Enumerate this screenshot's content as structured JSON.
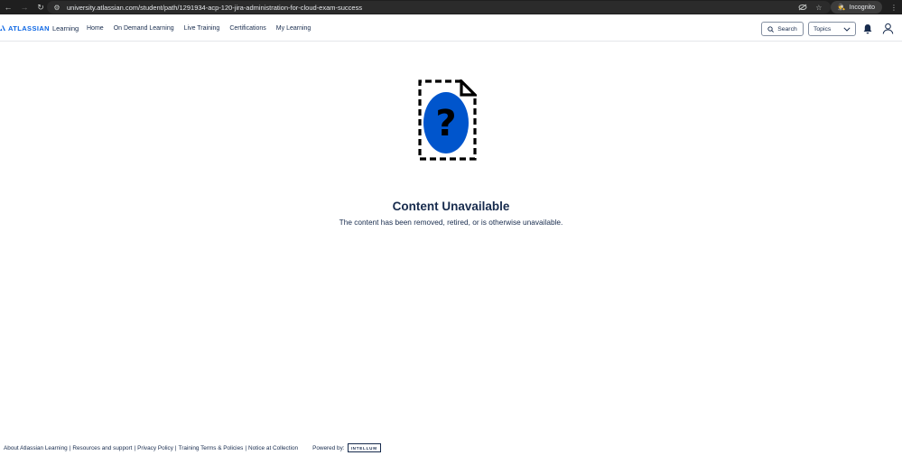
{
  "browser": {
    "url": "university.atlassian.com/student/path/1291934-acp-120-jira-administration-for-cloud-exam-success",
    "incognito_label": "Incognito",
    "icons": [
      "back-icon",
      "forward-icon",
      "reload-icon",
      "site-info-icon",
      "eye-off-icon",
      "star-icon",
      "incognito-icon",
      "menu-icon"
    ]
  },
  "header": {
    "brand": "ATLASSIAN",
    "brand_suffix": "Learning",
    "brand_color": "#0c66e4",
    "nav": [
      {
        "label": "Home"
      },
      {
        "label": "On Demand Learning"
      },
      {
        "label": "Live Training"
      },
      {
        "label": "Certifications"
      },
      {
        "label": "My Learning"
      }
    ],
    "search_label": "Search",
    "topics_label": "Topics",
    "icons": [
      "search-icon",
      "chevron-down-icon",
      "bell-icon",
      "user-icon"
    ]
  },
  "main": {
    "title": "Content Unavailable",
    "message": "The content has been removed, retired, or is otherwise unavailable.",
    "illustration_icon": "question-mark-icon",
    "illustration_color": "#0055cc"
  },
  "footer": {
    "links": [
      {
        "label": "About Atlassian Learning"
      },
      {
        "label": "Resources and support"
      },
      {
        "label": "Privacy Policy"
      },
      {
        "label": "Training Terms & Policies"
      },
      {
        "label": "Notice at Collection"
      }
    ],
    "powered_by": "Powered by:",
    "powered_brand": "INTELLUM"
  }
}
